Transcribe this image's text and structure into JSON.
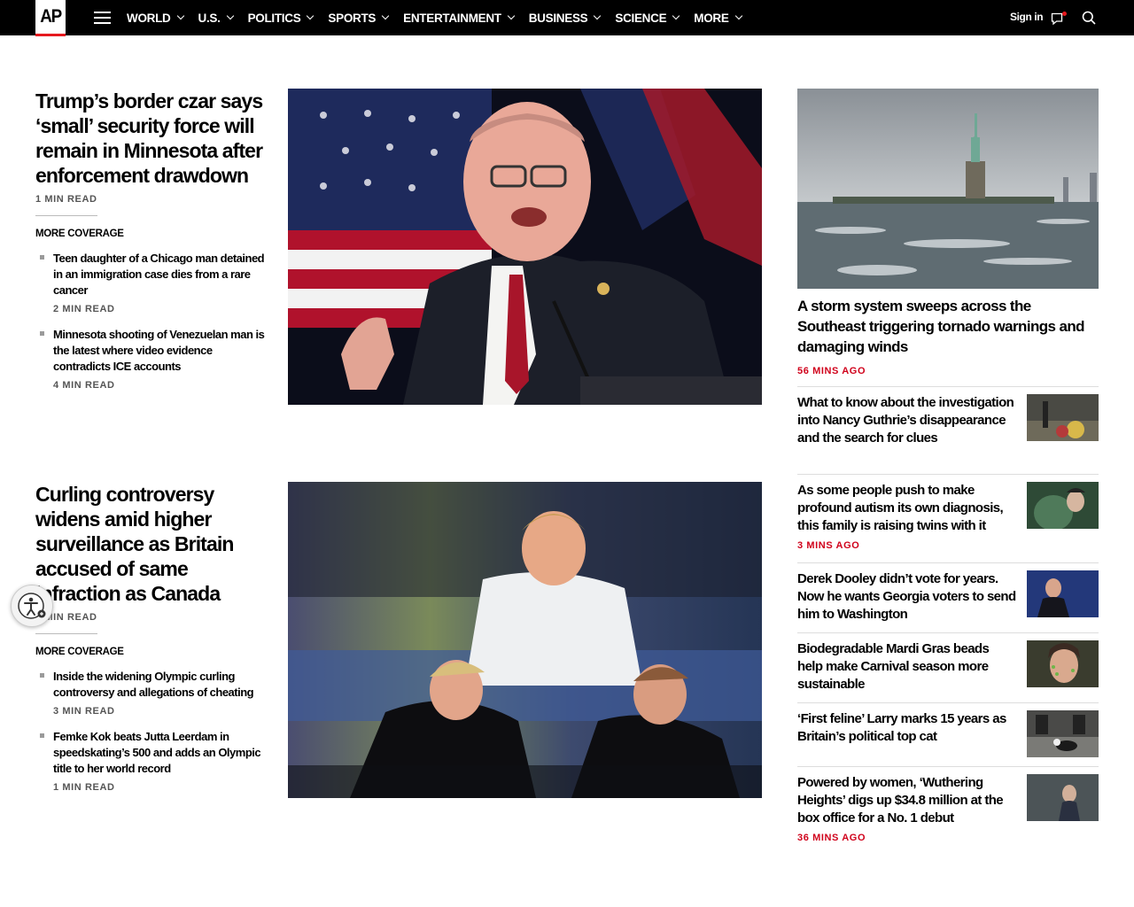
{
  "nav": {
    "logo": "AP",
    "items": [
      {
        "label": "WORLD"
      },
      {
        "label": "U.S."
      },
      {
        "label": "POLITICS"
      },
      {
        "label": "SPORTS"
      },
      {
        "label": "ENTERTAINMENT"
      },
      {
        "label": "BUSINESS"
      },
      {
        "label": "SCIENCE"
      },
      {
        "label": "MORE"
      }
    ],
    "signin": "Sign in",
    "icons": [
      "menu-icon",
      "chat-icon",
      "search-icon"
    ],
    "brand_color": "#e6191e"
  },
  "leads": [
    {
      "title": "Trump’s border czar says ‘small’ security force will remain in Minnesota after enforcement drawdown",
      "readtime": "1 MIN READ",
      "more_coverage_label": "MORE COVERAGE",
      "subs": [
        {
          "title": "Teen daughter of a Chicago man detained in an immigration case dies from a rare cancer",
          "readtime": "2 MIN READ"
        },
        {
          "title": "Minnesota shooting of Venezuelan man is the latest where video evidence contradicts ICE accounts",
          "readtime": "4 MIN READ"
        }
      ]
    },
    {
      "title": "Curling controversy widens amid higher surveillance as Britain accused of same infraction as Canada",
      "readtime": "1 MIN READ",
      "more_coverage_label": "MORE COVERAGE",
      "subs": [
        {
          "title": "Inside the widening Olympic curling controversy and allegations of cheating",
          "readtime": "3 MIN READ"
        },
        {
          "title": "Femke Kok beats Jutta Leerdam in speedskating’s 500 and adds an Olympic title to her world record",
          "readtime": "1 MIN READ"
        }
      ]
    }
  ],
  "rail": {
    "lead": {
      "title": "A storm system sweeps across the Southeast triggering tornado warnings and damaging winds",
      "ago": "56 MINS AGO"
    },
    "items": [
      {
        "title": "What to know about the investigation into Nancy Guthrie’s disappearance and the search for clues",
        "ago": ""
      },
      {
        "title": "As some people push to make profound autism its own diagnosis, this family is raising twins with it",
        "ago": "3 MINS AGO"
      },
      {
        "title": "Derek Dooley didn’t vote for years. Now he wants Georgia voters to send him to Washington",
        "ago": ""
      },
      {
        "title": "Biodegradable Mardi Gras beads help make Carnival season more sustainable",
        "ago": ""
      },
      {
        "title": "‘First feline’ Larry marks 15 years as Britain’s political top cat",
        "ago": ""
      },
      {
        "title": "Powered by women, ‘Wuthering Heights’ digs up $34.8 million at the box office for a No. 1 debut",
        "ago": "36 MINS AGO"
      }
    ],
    "accent_color": "#d0021b"
  }
}
